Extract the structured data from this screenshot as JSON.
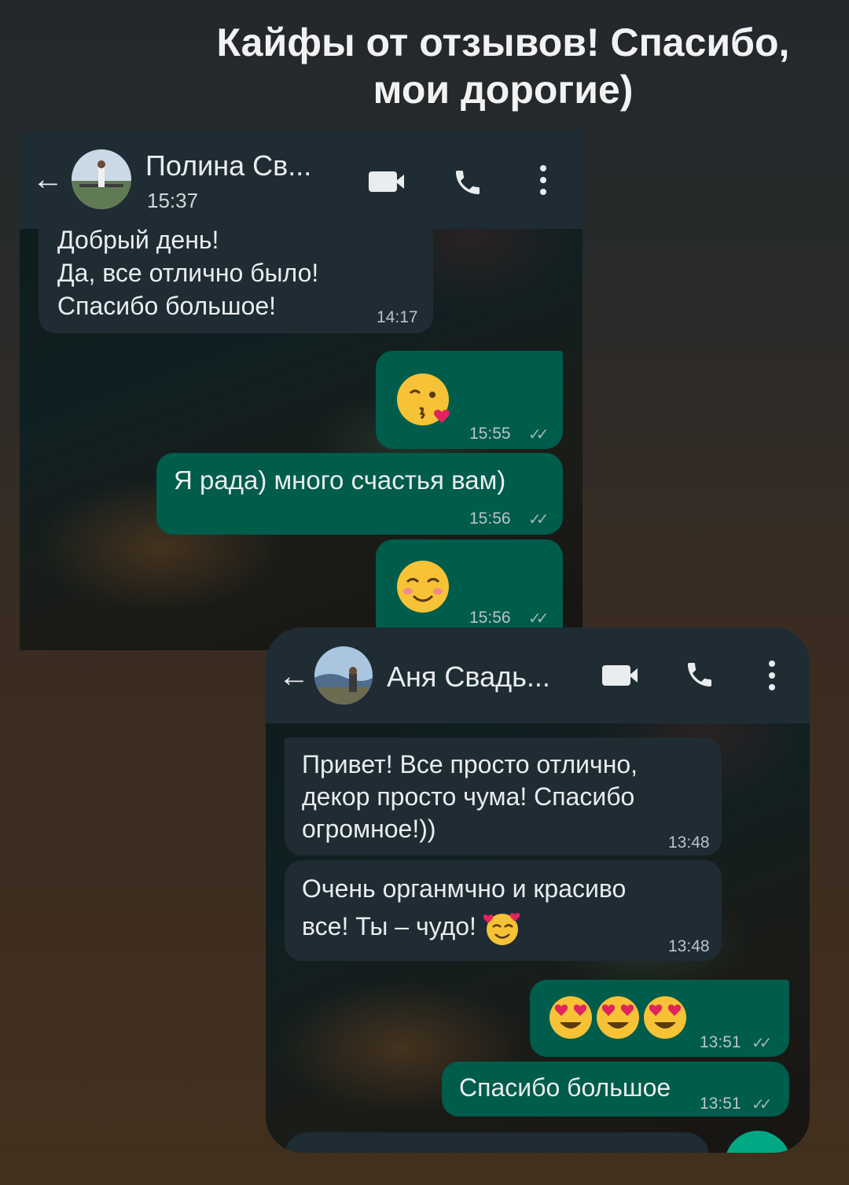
{
  "headline": {
    "line1": "Кайфы от отзывов! Спасибо,",
    "line2": "мои дорогие)"
  },
  "chat1": {
    "contact_name": "Полина Св...",
    "status": "15:37",
    "messages": [
      {
        "direction": "in",
        "lines": [
          "Добрый день!",
          "Да, все отлично было!",
          "Спасибо большое!"
        ],
        "time": "14:17"
      },
      {
        "direction": "out",
        "emoji": "kissing-face-with-heart",
        "time": "15:55"
      },
      {
        "direction": "out",
        "text": "Я рада) много счастья вам)",
        "time": "15:56"
      },
      {
        "direction": "out",
        "emoji": "smiling-face",
        "time": "15:56"
      }
    ]
  },
  "chat2": {
    "contact_name": "Аня Свадь...",
    "messages": [
      {
        "direction": "in",
        "lines": [
          "Привет! Все просто отлично,",
          "декор просто чума! Спасибо",
          "огромное!))"
        ],
        "time": "13:48"
      },
      {
        "direction": "in",
        "lines": [
          "Очень органмчно и красиво",
          "все! Ты – чудо!"
        ],
        "emoji": "smiling-face-with-hearts",
        "time": "13:48"
      },
      {
        "direction": "out",
        "emoji": "heart-eyes x3",
        "time": "13:51"
      },
      {
        "direction": "out",
        "text": "Спасибо большое",
        "time": "13:51"
      }
    ]
  },
  "colors": {
    "appbar": "#1f2c34",
    "incoming_bubble": "#1f2c34",
    "outgoing_bubble": "#005c4b",
    "text": "#e9edef"
  }
}
